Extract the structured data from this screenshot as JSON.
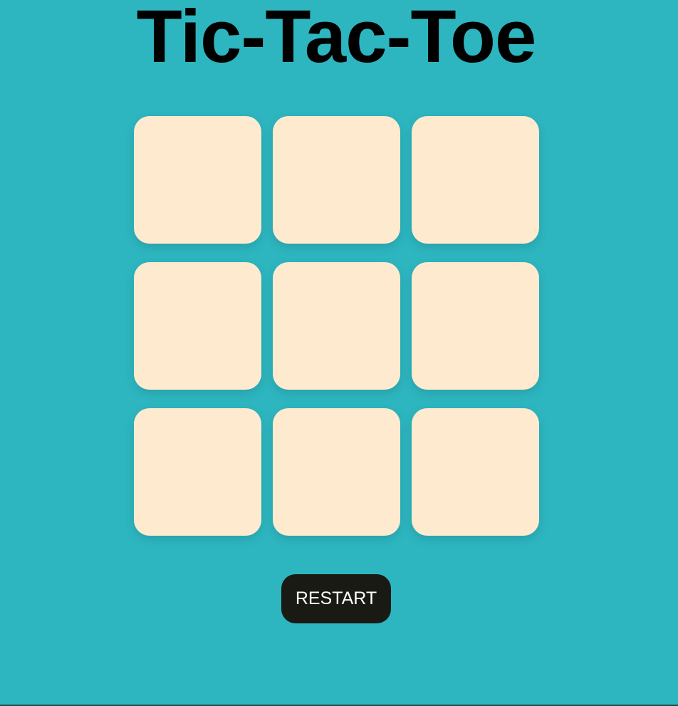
{
  "game": {
    "title": "Tic-Tac-Toe"
  },
  "board": {
    "cells": [
      "",
      "",
      "",
      "",
      "",
      "",
      "",
      "",
      ""
    ]
  },
  "controls": {
    "restart_label": "RESTART"
  },
  "colors": {
    "background": "#2db6c0",
    "cell": "#feebcf",
    "button": "#1a1a14",
    "button_text": "#ffffff",
    "title": "#000000"
  }
}
